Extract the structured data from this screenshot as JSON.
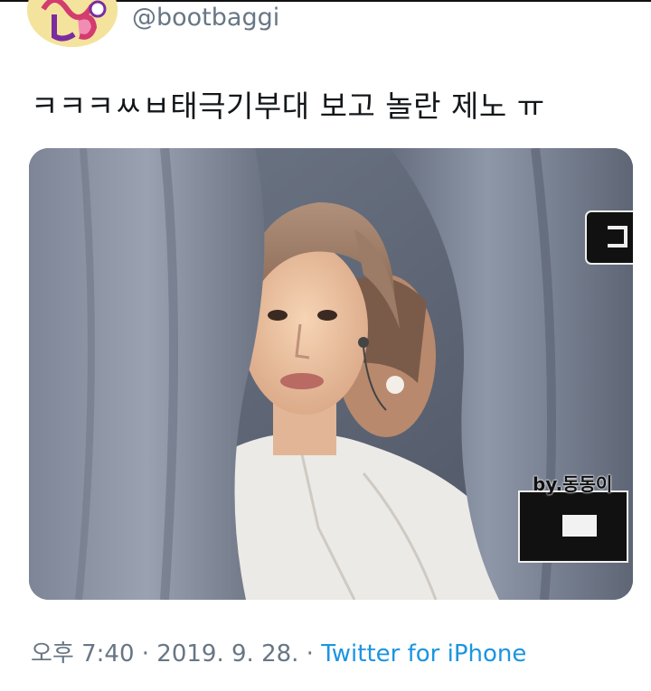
{
  "tweet": {
    "handle": "@bootbaggi",
    "text": "ㅋㅋㅋㅆㅂ태극기부대 보고 놀란 제노 ㅠ",
    "avatar_icon": "profile-avatar-icon"
  },
  "media": {
    "watermark": "by.동동이"
  },
  "meta": {
    "time": "오후 7:40",
    "separator": " · ",
    "date": "2019. 9. 28.",
    "separator2": " · ",
    "source": "Twitter for iPhone"
  },
  "colors": {
    "text": "#14171a",
    "secondary": "#687684",
    "link": "#1b95e0"
  }
}
